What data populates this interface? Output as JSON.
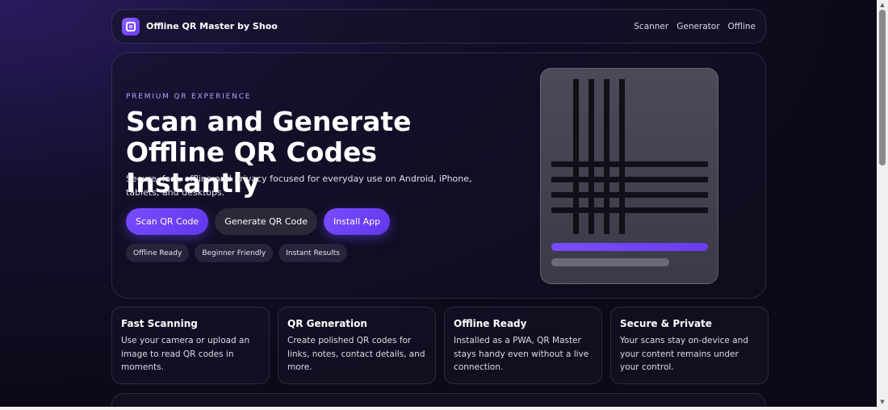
{
  "nav": {
    "brand": "Offline QR Master by Shoo",
    "links": [
      "Scanner",
      "Generator",
      "Offline"
    ]
  },
  "hero": {
    "eyebrow": "PREMIUM QR EXPERIENCE",
    "title": "Scan and Generate Offline QR Codes Instantly",
    "description": "Secure, fast, offline and privacy focused for everyday use on Android, iPhone, tablets, and desktops.",
    "buttons": {
      "scan": "Scan QR Code",
      "generate": "Generate QR Code",
      "install": "Install App"
    },
    "chips": [
      "Offline Ready",
      "Beginner Friendly",
      "Instant Results"
    ]
  },
  "features": [
    {
      "title": "Fast Scanning",
      "text": "Use your camera or upload an image to read QR codes in moments."
    },
    {
      "title": "QR Generation",
      "text": "Create polished QR codes for links, notes, contact details, and more."
    },
    {
      "title": "Offline Ready",
      "text": "Installed as a PWA, QR Master stays handy even without a live connection."
    },
    {
      "title": "Secure & Private",
      "text": "Your scans stay on-device and your content remains under your control."
    }
  ],
  "colors": {
    "accent": "#7a4cff",
    "background": "#0b0a18",
    "card": "#141226"
  }
}
